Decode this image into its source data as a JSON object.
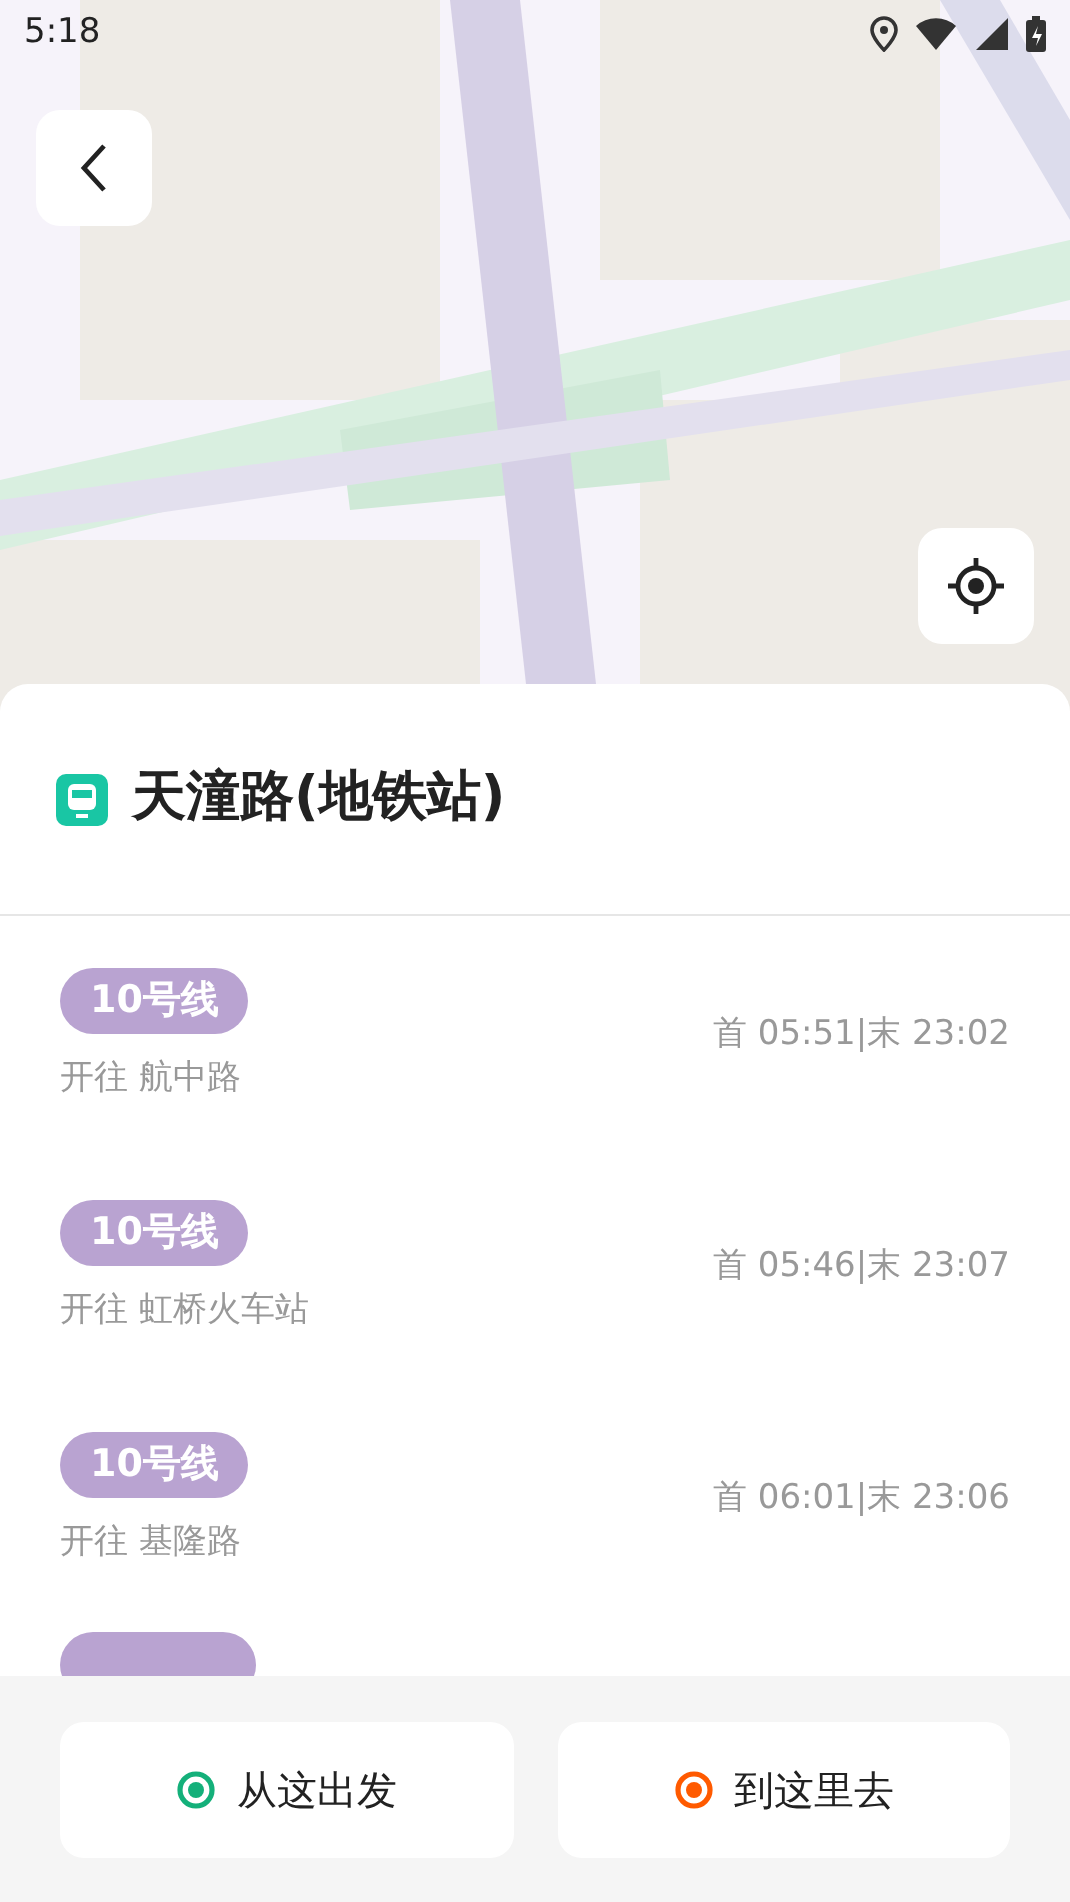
{
  "status_bar": {
    "time": "5:18"
  },
  "station": {
    "name": "天潼路(地铁站)"
  },
  "lines": [
    {
      "line": "10号线",
      "direction": "开往 航中路",
      "hours": "首 05:51|末 23:02"
    },
    {
      "line": "10号线",
      "direction": "开往 虹桥火车站",
      "hours": "首 05:46|末 23:07"
    },
    {
      "line": "10号线",
      "direction": "开往 基隆路",
      "hours": "首 06:01|末 23:06"
    }
  ],
  "actions": [
    {
      "kind": "start",
      "label": "从这出发"
    },
    {
      "kind": "end",
      "label": "到这里去"
    }
  ]
}
